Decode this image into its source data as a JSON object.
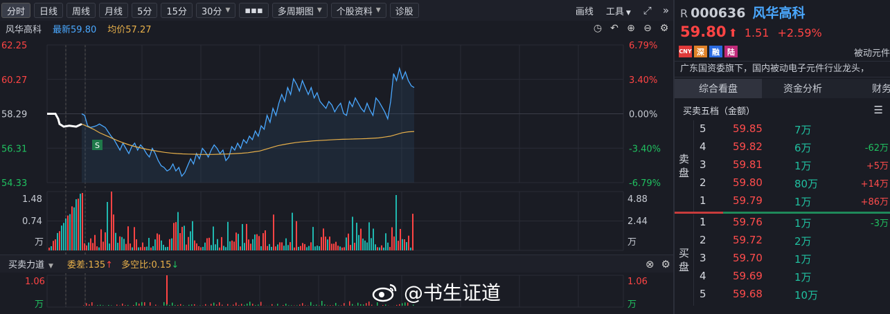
{
  "toolbar": {
    "buttons": [
      "分时",
      "日线",
      "周线",
      "月线",
      "5分",
      "15分",
      "30分",
      "▪▪▪",
      "多周期图",
      "个股资料",
      "诊股"
    ],
    "right_draw": "画线",
    "right_tools": "工具",
    "expand_icon": "expand-icon",
    "collapse_icon": "double-chevron-right-icon"
  },
  "info": {
    "name": "风华高科",
    "latest_label": "最新",
    "latest_value": "59.80",
    "avg_label": "均价",
    "avg_value": "57.27"
  },
  "colors": {
    "price_line": "#4aa8ff",
    "avg_line": "#e8b04a",
    "up": "#ff4444",
    "down": "#20c060",
    "volume_up": "#ff4444",
    "volume_down": "#20b8b0",
    "background": "#1a1c24"
  },
  "chart_data": {
    "type": "line",
    "price_axis_left": [
      "62.25",
      "60.27",
      "58.29",
      "56.31",
      "54.33"
    ],
    "price_axis_right": [
      "6.79%",
      "3.40%",
      "0.00%",
      "-3.40%",
      "-6.79%"
    ],
    "ylim": [
      54.33,
      62.25
    ],
    "prev_close": 58.29,
    "price_series": [
      58.29,
      58.2,
      57.6,
      57.5,
      57.55,
      57.6,
      57.7,
      57.6,
      57.5,
      57.25,
      57.0,
      56.8,
      56.5,
      56.2,
      56.6,
      56.3,
      56.0,
      56.4,
      56.6,
      56.2,
      56.5,
      56.3,
      56.0,
      55.8,
      56.3,
      56.0,
      55.6,
      55.3,
      55.2,
      55.0,
      55.1,
      55.4,
      55.0,
      55.2,
      54.7,
      54.9,
      55.3,
      55.7,
      55.4,
      56.0,
      55.7,
      56.3,
      56.1,
      55.8,
      56.2,
      56.5,
      56.3,
      56.0,
      56.2,
      55.6,
      55.8,
      56.4,
      56.2,
      56.6,
      56.3,
      56.8,
      56.6,
      57.0,
      56.8,
      57.3,
      57.0,
      57.6,
      57.4,
      58.2,
      57.8,
      58.6,
      58.2,
      58.9,
      59.4,
      59.0,
      59.8,
      59.4,
      60.3,
      60.0,
      59.6,
      60.2,
      59.8,
      59.4,
      59.8,
      59.2,
      59.5,
      59.0,
      58.8,
      58.6,
      59.0,
      58.8,
      58.4,
      58.7,
      58.9,
      58.3,
      58.2,
      59.0,
      58.7,
      59.2,
      58.9,
      58.6,
      58.4,
      58.9,
      58.5,
      58.2,
      59.2,
      59.0,
      58.7,
      58.4,
      58.0,
      59.0,
      60.6,
      60.2,
      60.9,
      60.3,
      60.7,
      60.2,
      59.9,
      59.8
    ],
    "avg_series": [
      57.7,
      57.55,
      57.4,
      57.2,
      57.05,
      56.9,
      56.75,
      56.62,
      56.5,
      56.4,
      56.32,
      56.24,
      56.18,
      56.12,
      56.07,
      56.03,
      56.0,
      55.98,
      55.97,
      55.96,
      55.95,
      55.95,
      55.95,
      55.96,
      55.97,
      55.98,
      56.0,
      56.02,
      56.05,
      56.1,
      56.15,
      56.25,
      56.35,
      56.45,
      56.52,
      56.58,
      56.63,
      56.67,
      56.7,
      56.73,
      56.75,
      56.77,
      56.79,
      56.81,
      56.82,
      56.83,
      56.84,
      56.85,
      56.86,
      56.88,
      56.9,
      56.95,
      57.0,
      57.1,
      57.2,
      57.25,
      57.27
    ],
    "volume_axis_left": [
      "1.48",
      "0.74",
      "万"
    ],
    "volume_axis_right": [
      "4.88",
      "2.44",
      "万"
    ],
    "force_axis_left": [
      "1.06",
      "万"
    ],
    "force_axis_right": [
      "1.06",
      "万"
    ],
    "marker_label": "S"
  },
  "force_bar": {
    "label": "买卖力道",
    "diff_label": "委差:",
    "diff_value": "135",
    "ratio_label": "多空比:",
    "ratio_value": "0.15"
  },
  "panel": {
    "r_label": "R",
    "code": "000636",
    "name": "风华高科",
    "price": "59.80",
    "change": "1.51",
    "change_pct": "+2.59%",
    "tags": [
      "CNY",
      "深",
      "融",
      "陆"
    ],
    "tag_text": "被动元件",
    "desc": "广东国资委旗下，国内被动电子元件行业龙头，",
    "tabs": [
      "综合看盘",
      "资金分析",
      "财务"
    ],
    "section": "买卖五档（金额）",
    "sell_label": [
      "卖",
      "盘"
    ],
    "buy_label": [
      "买",
      "盘"
    ],
    "sell": [
      {
        "level": "5",
        "price": "59.85",
        "vol": "7万",
        "delta": ""
      },
      {
        "level": "4",
        "price": "59.82",
        "vol": "6万",
        "delta": "-62万"
      },
      {
        "level": "3",
        "price": "59.81",
        "vol": "1万",
        "delta": "+5万"
      },
      {
        "level": "2",
        "price": "59.80",
        "vol": "80万",
        "delta": "+14万"
      },
      {
        "level": "1",
        "price": "59.79",
        "vol": "1万",
        "delta": "+86万"
      }
    ],
    "buy": [
      {
        "level": "1",
        "price": "59.76",
        "vol": "1万",
        "delta": "-3万"
      },
      {
        "level": "2",
        "price": "59.72",
        "vol": "2万",
        "delta": ""
      },
      {
        "level": "3",
        "price": "59.70",
        "vol": "1万",
        "delta": ""
      },
      {
        "level": "4",
        "price": "59.69",
        "vol": "1万",
        "delta": ""
      },
      {
        "level": "5",
        "price": "59.68",
        "vol": "10万",
        "delta": ""
      }
    ]
  },
  "watermark": "@书生证道"
}
